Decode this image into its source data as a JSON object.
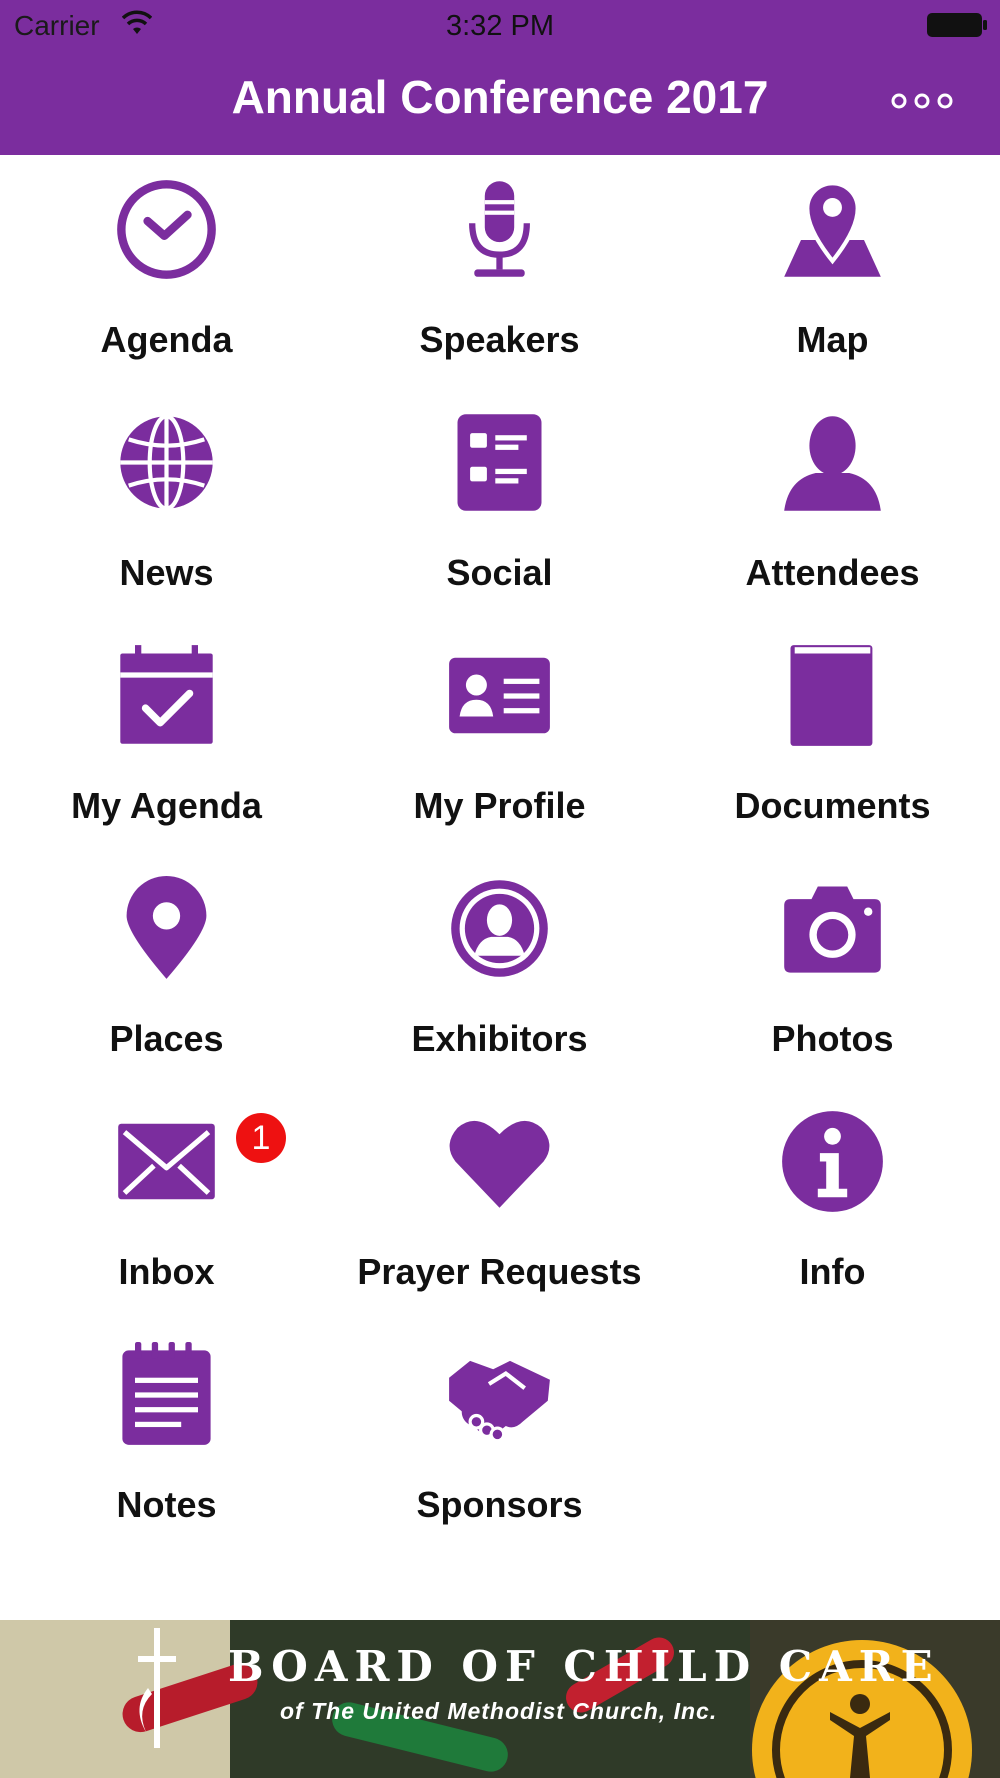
{
  "status_bar": {
    "carrier": "Carrier",
    "time": "3:32 PM",
    "wifi_icon": "wifi-icon",
    "battery_icon": "battery-icon"
  },
  "header": {
    "title": "Annual Conference 2017",
    "more_icon": "more-dots-icon"
  },
  "theme": {
    "accent": "#7b2d9e",
    "badge": "#ee1111",
    "text": "#111111"
  },
  "menu": {
    "items": [
      {
        "label": "Agenda",
        "icon": "clock-check-icon"
      },
      {
        "label": "Speakers",
        "icon": "microphone-icon"
      },
      {
        "label": "Map",
        "icon": "map-pin-icon"
      },
      {
        "label": "News",
        "icon": "globe-icon"
      },
      {
        "label": "Social",
        "icon": "list-card-icon"
      },
      {
        "label": "Attendees",
        "icon": "person-icon"
      },
      {
        "label": "My Agenda",
        "icon": "calendar-check-icon"
      },
      {
        "label": "My Profile",
        "icon": "id-card-icon"
      },
      {
        "label": "Documents",
        "icon": "book-icon"
      },
      {
        "label": "Places",
        "icon": "location-pin-icon"
      },
      {
        "label": "Exhibitors",
        "icon": "person-circle-icon"
      },
      {
        "label": "Photos",
        "icon": "camera-icon"
      },
      {
        "label": "Inbox",
        "icon": "envelope-icon",
        "badge": "1"
      },
      {
        "label": "Prayer Requests",
        "icon": "heart-icon"
      },
      {
        "label": "Info",
        "icon": "info-icon"
      },
      {
        "label": "Notes",
        "icon": "notepad-icon"
      },
      {
        "label": "Sponsors",
        "icon": "handshake-icon"
      }
    ]
  },
  "banner": {
    "headline": "BOARD OF CHILD CARE",
    "subline": "of The United Methodist Church, Inc."
  }
}
